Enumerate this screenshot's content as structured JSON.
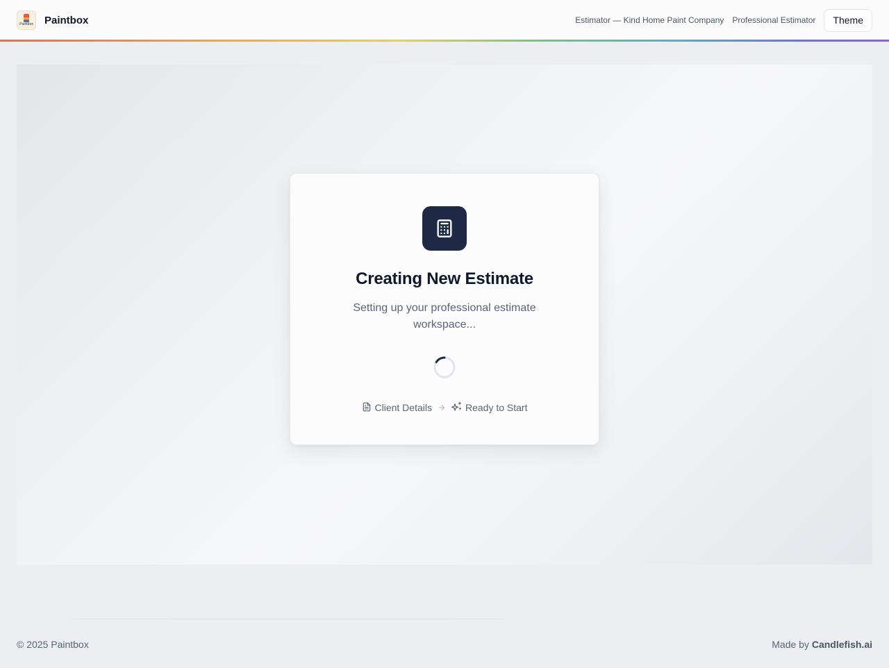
{
  "header": {
    "brand_name": "Paintbox",
    "logo_text": "Paintbox",
    "company": "Estimator — Kind Home Paint Company",
    "role": "Professional Estimator",
    "theme_label": "Theme"
  },
  "card": {
    "icon": "calculator-icon",
    "title": "Creating New Estimate",
    "subtitle": "Setting up your professional estimate workspace...",
    "steps": [
      {
        "icon": "document-icon",
        "label": "Client Details"
      },
      {
        "icon": "sparkles-icon",
        "label": "Ready to Start"
      }
    ]
  },
  "footer": {
    "copyright": "© 2025 Paintbox",
    "made_by_prefix": "Made by",
    "made_by_name": "Candlefish.ai"
  },
  "colors": {
    "accent_dark": "#1e2a45",
    "background": "#eceef2",
    "text_muted": "#5b6475"
  }
}
